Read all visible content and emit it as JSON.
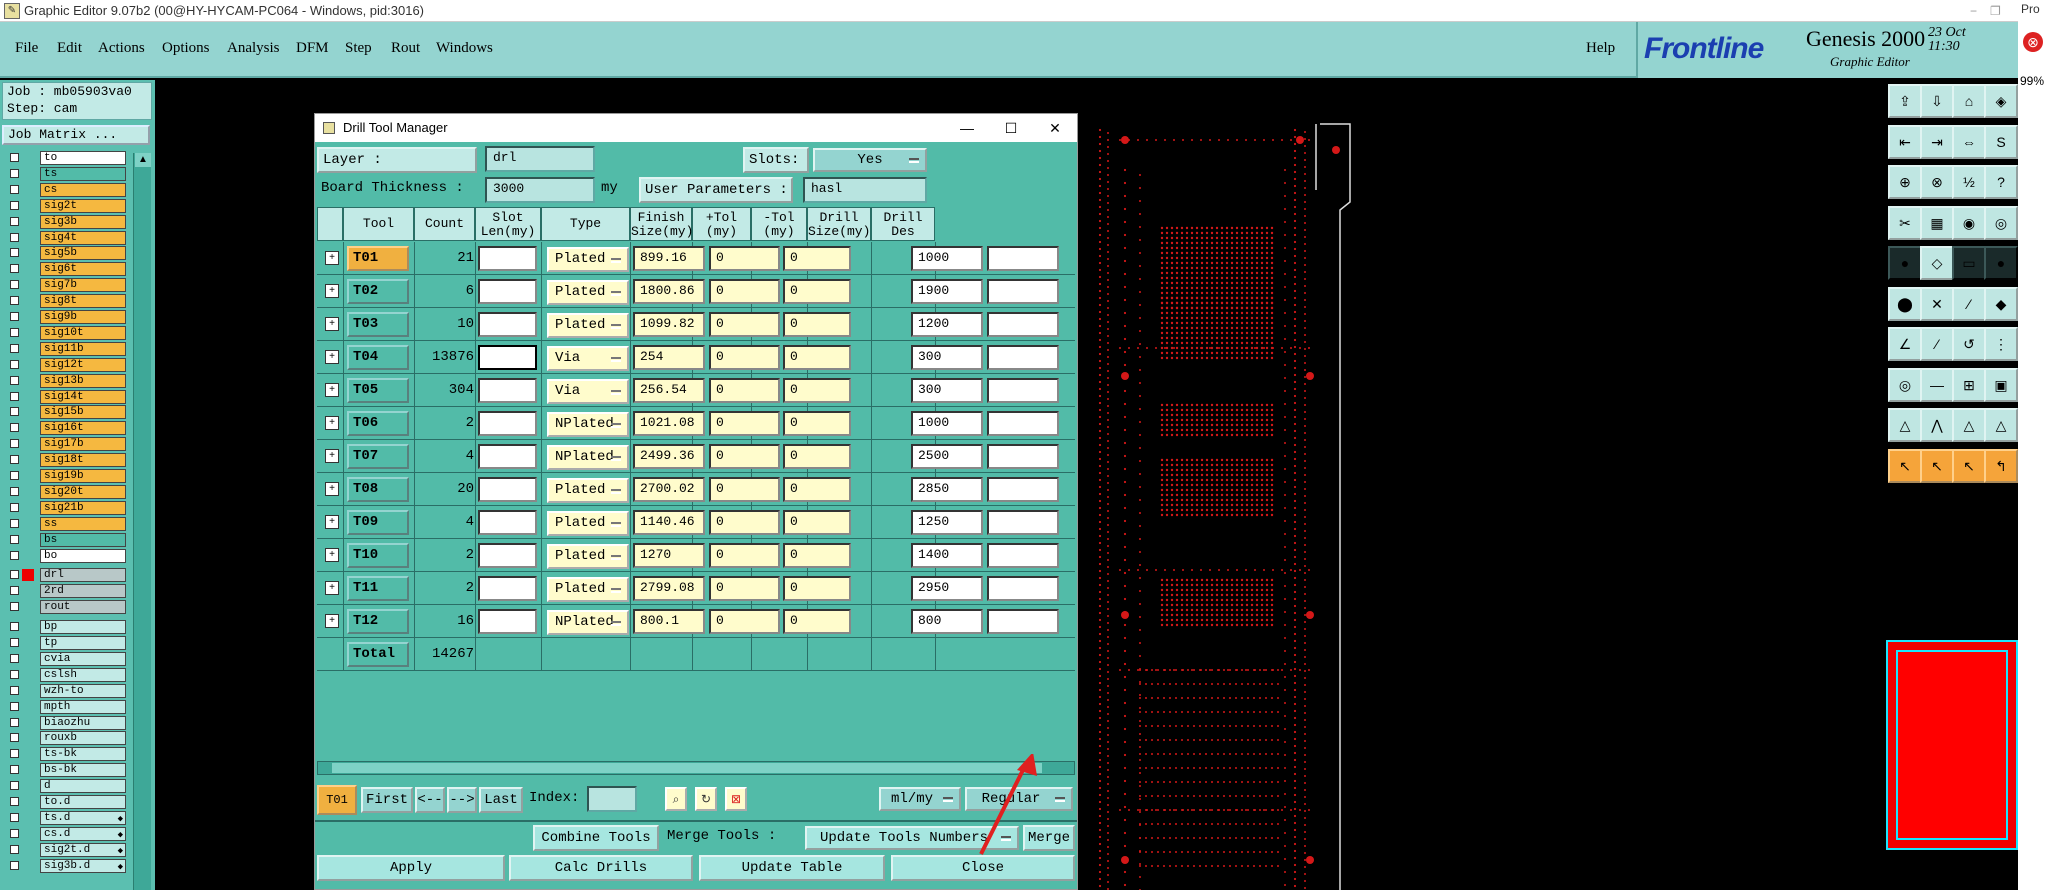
{
  "window_title": "Graphic Editor 9.07b2 (00@HY-HYCAM-PC064 - Windows, pid:3016)",
  "menu": [
    "File",
    "Edit",
    "Actions",
    "Options",
    "Analysis",
    "DFM",
    "Step",
    "Rout",
    "Windows"
  ],
  "help": "Help",
  "brand": {
    "frontline": "Frontline",
    "product": "Genesis 2000",
    "subtitle": "Graphic Editor",
    "date": "23 Oct",
    "time": "11:30"
  },
  "zoom": "99%",
  "job": {
    "job_line": "Job : mb05903va0",
    "step_line": "Step: cam",
    "matrix_button": "Job Matrix ..."
  },
  "layers_group1": [
    {
      "name": "to",
      "color": "#ffffff"
    },
    {
      "name": "ts",
      "color": "#52bba8"
    },
    {
      "name": "cs",
      "color": "#f5b840"
    },
    {
      "name": "sig2t",
      "color": "#f5b840"
    },
    {
      "name": "sig3b",
      "color": "#f5b840"
    },
    {
      "name": "sig4t",
      "color": "#f5b840"
    },
    {
      "name": "sig5b",
      "color": "#f5b840"
    },
    {
      "name": "sig6t",
      "color": "#f5b840"
    },
    {
      "name": "sig7b",
      "color": "#f5b840"
    },
    {
      "name": "sig8t",
      "color": "#f5b840"
    },
    {
      "name": "sig9b",
      "color": "#f5b840"
    },
    {
      "name": "sig10t",
      "color": "#f5b840"
    },
    {
      "name": "sig11b",
      "color": "#f5b840"
    },
    {
      "name": "sig12t",
      "color": "#f5b840"
    },
    {
      "name": "sig13b",
      "color": "#f5b840"
    },
    {
      "name": "sig14t",
      "color": "#f5b840"
    },
    {
      "name": "sig15b",
      "color": "#f5b840"
    },
    {
      "name": "sig16t",
      "color": "#f5b840"
    },
    {
      "name": "sig17b",
      "color": "#f5b840"
    },
    {
      "name": "sig18t",
      "color": "#f5b840"
    },
    {
      "name": "sig19b",
      "color": "#f5b840"
    },
    {
      "name": "sig20t",
      "color": "#f5b840"
    },
    {
      "name": "sig21b",
      "color": "#f5b840"
    },
    {
      "name": "ss",
      "color": "#f5b840"
    },
    {
      "name": "bs",
      "color": "#52bba8"
    },
    {
      "name": "bo",
      "color": "#ffffff"
    }
  ],
  "layers_group2": [
    {
      "name": "drl",
      "color": "#b8c8c8"
    },
    {
      "name": "2rd",
      "color": "#b8c8c8"
    },
    {
      "name": "rout",
      "color": "#b8c8c8"
    }
  ],
  "layers_group3": [
    {
      "name": "bp",
      "color": "#c2eae6"
    },
    {
      "name": "tp",
      "color": "#c2eae6"
    },
    {
      "name": "cvia",
      "color": "#c2eae6"
    },
    {
      "name": "cslsh",
      "color": "#c2eae6"
    },
    {
      "name": "wzh-to",
      "color": "#c2eae6"
    },
    {
      "name": "mpth",
      "color": "#c2eae6"
    },
    {
      "name": "biaozhu",
      "color": "#c2eae6"
    },
    {
      "name": "rouxb",
      "color": "#c2eae6"
    },
    {
      "name": "ts-bk",
      "color": "#c2eae6"
    },
    {
      "name": "bs-bk",
      "color": "#c2eae6"
    },
    {
      "name": "d",
      "color": "#c2eae6"
    },
    {
      "name": "to.d",
      "color": "#c2eae6"
    },
    {
      "name": "ts.d",
      "color": "#c2eae6"
    },
    {
      "name": "cs.d",
      "color": "#c2eae6"
    },
    {
      "name": "sig2t.d",
      "color": "#c2eae6"
    },
    {
      "name": "sig3b.d",
      "color": "#c2eae6"
    }
  ],
  "dialog": {
    "title": "Drill Tool Manager",
    "layer_label": "Layer :",
    "layer_value": "drl",
    "slots_label": "Slots:",
    "slots_value": "Yes",
    "thickness_label": "Board Thickness :",
    "thickness_value": "3000",
    "thickness_unit": "my",
    "user_params_label": "User Parameters :",
    "user_params_value": "hasl",
    "columns": [
      "Tool",
      "Count",
      "Slot Len(my)",
      "Type",
      "Finish Size(my)",
      "+Tol (my)",
      "-Tol (my)",
      "Drill Size(my)",
      "Drill Des"
    ],
    "rows": [
      {
        "tool": "T01",
        "count": "21",
        "slot": "",
        "type": "Plated",
        "finish": "899.16",
        "ptol": "0",
        "ntol": "0",
        "drill": "1000",
        "des": ""
      },
      {
        "tool": "T02",
        "count": "6",
        "slot": "",
        "type": "Plated",
        "finish": "1800.86",
        "ptol": "0",
        "ntol": "0",
        "drill": "1900",
        "des": ""
      },
      {
        "tool": "T03",
        "count": "10",
        "slot": "",
        "type": "Plated",
        "finish": "1099.82",
        "ptol": "0",
        "ntol": "0",
        "drill": "1200",
        "des": ""
      },
      {
        "tool": "T04",
        "count": "13876",
        "slot": "",
        "type": "Via",
        "finish": "254",
        "ptol": "0",
        "ntol": "0",
        "drill": "300",
        "des": ""
      },
      {
        "tool": "T05",
        "count": "304",
        "slot": "",
        "type": "Via",
        "finish": "256.54",
        "ptol": "0",
        "ntol": "0",
        "drill": "300",
        "des": ""
      },
      {
        "tool": "T06",
        "count": "2",
        "slot": "",
        "type": "NPlated",
        "finish": "1021.08",
        "ptol": "0",
        "ntol": "0",
        "drill": "1000",
        "des": ""
      },
      {
        "tool": "T07",
        "count": "4",
        "slot": "",
        "type": "NPlated",
        "finish": "2499.36",
        "ptol": "0",
        "ntol": "0",
        "drill": "2500",
        "des": ""
      },
      {
        "tool": "T08",
        "count": "20",
        "slot": "",
        "type": "Plated",
        "finish": "2700.02",
        "ptol": "0",
        "ntol": "0",
        "drill": "2850",
        "des": ""
      },
      {
        "tool": "T09",
        "count": "4",
        "slot": "",
        "type": "Plated",
        "finish": "1140.46",
        "ptol": "0",
        "ntol": "0",
        "drill": "1250",
        "des": ""
      },
      {
        "tool": "T10",
        "count": "2",
        "slot": "",
        "type": "Plated",
        "finish": "1270",
        "ptol": "0",
        "ntol": "0",
        "drill": "1400",
        "des": ""
      },
      {
        "tool": "T11",
        "count": "2",
        "slot": "",
        "type": "Plated",
        "finish": "2799.08",
        "ptol": "0",
        "ntol": "0",
        "drill": "2950",
        "des": ""
      },
      {
        "tool": "T12",
        "count": "16",
        "slot": "",
        "type": "NPlated",
        "finish": "800.1",
        "ptol": "0",
        "ntol": "0",
        "drill": "800",
        "des": ""
      }
    ],
    "total_label": "Total",
    "total_count": "14267",
    "nav": {
      "current": "T01",
      "first": "First",
      "prev": "<--",
      "next": "-->",
      "last": "Last",
      "index_label": "Index:",
      "index_value": "",
      "units": "ml/my",
      "mode": "Regular"
    },
    "merge": {
      "combine": "Combine Tools",
      "merge_label": "Merge Tools :",
      "update_numbers": "Update Tools Numbers",
      "merge": "Merge"
    },
    "actions": {
      "apply": "Apply",
      "calc": "Calc Drills",
      "update": "Update Table",
      "close": "Close"
    }
  }
}
